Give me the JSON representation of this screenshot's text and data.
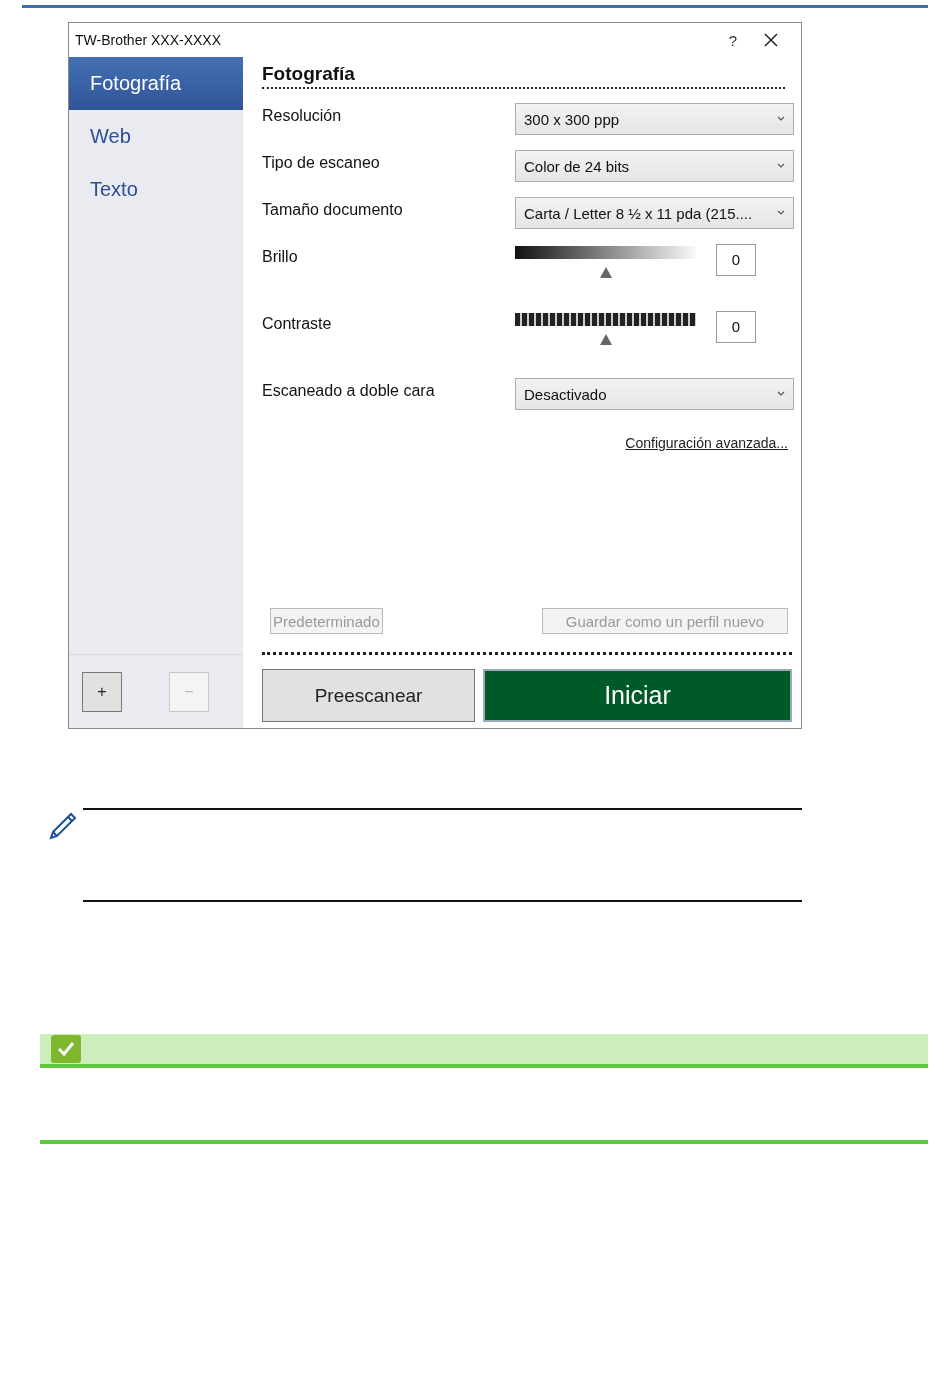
{
  "window": {
    "title": "TW-Brother XXX-XXXX",
    "help": "?"
  },
  "sidebar": {
    "items": [
      {
        "label": "Fotografía",
        "selected": true
      },
      {
        "label": "Web",
        "selected": false
      },
      {
        "label": "Texto",
        "selected": false
      }
    ],
    "buttons": [
      {
        "label": "+",
        "disabled": false
      },
      {
        "label": "−",
        "disabled": true
      }
    ]
  },
  "panel": {
    "heading": "Fotografía",
    "settings": [
      {
        "kind": "select",
        "label": "Resolución",
        "value": "300 x 300 ppp"
      },
      {
        "kind": "select",
        "label": "Tipo de escaneo",
        "value": "Color de 24 bits"
      },
      {
        "kind": "select",
        "label": "Tamaño documento",
        "value": "Carta / Letter 8 ½ x 11 pda (215...."
      },
      {
        "kind": "gradient",
        "label": "Brillo",
        "level": 0.5,
        "value": "0"
      },
      {
        "kind": "stripes",
        "label": "Contraste",
        "level": 0.5,
        "value": "0"
      },
      {
        "kind": "select",
        "label": "Escaneado a doble cara",
        "value": "Desactivado"
      }
    ],
    "link": "Configuración avanzada...",
    "profile_buttons": [
      {
        "label": "Predeterminado",
        "disabled": true
      },
      {
        "label": "Guardar como un perfil nuevo",
        "disabled": true
      }
    ],
    "action_buttons": [
      {
        "label": "Preescanear",
        "kind": "secondary"
      },
      {
        "label": "Iniciar",
        "kind": "primary"
      }
    ]
  }
}
